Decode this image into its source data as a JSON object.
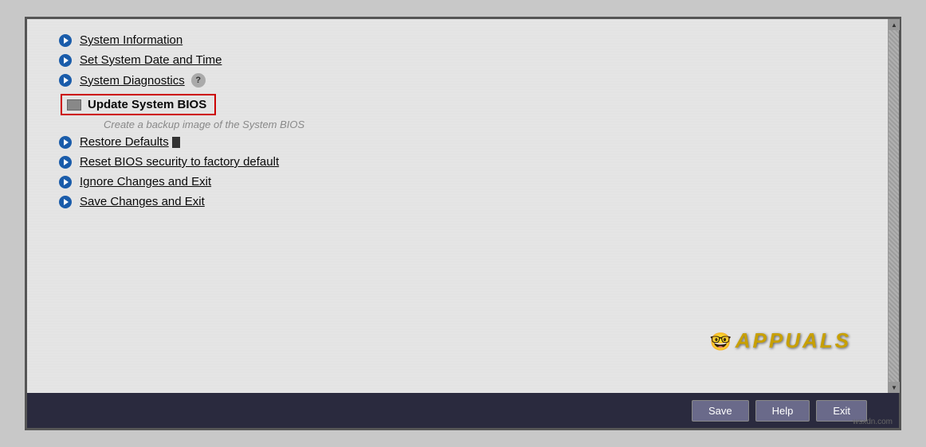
{
  "bios": {
    "menu_items": [
      {
        "id": "system-information",
        "label": "System Information",
        "has_bullet": true
      },
      {
        "id": "set-date-time",
        "label": "Set System Date and Time",
        "has_bullet": true
      },
      {
        "id": "system-diagnostics",
        "label": "System Diagnostics",
        "has_bullet": true,
        "has_help": true
      },
      {
        "id": "update-bios",
        "label": "Update System BIOS",
        "has_bullet": false,
        "highlighted": true
      },
      {
        "id": "backup-text",
        "label": "Create a backup image of the System BIOS",
        "is_subtext": true
      },
      {
        "id": "restore-defaults",
        "label": "Restore Defaults",
        "has_bullet": true
      },
      {
        "id": "reset-bios",
        "label": "Reset BIOS security to factory default",
        "has_bullet": true
      },
      {
        "id": "ignore-changes",
        "label": "Ignore Changes and Exit",
        "has_bullet": true
      },
      {
        "id": "save-changes",
        "label": "Save Changes and Exit",
        "has_bullet": true
      }
    ],
    "bottom_buttons": [
      {
        "id": "save",
        "label": "Save"
      },
      {
        "id": "help",
        "label": "Help"
      },
      {
        "id": "exit",
        "label": "Exit"
      }
    ],
    "appuals": {
      "text": "APPUALS",
      "mascot": "🤓"
    }
  },
  "scrollbar": {
    "up_arrow": "▲",
    "down_arrow": "▼"
  },
  "watermark": "wsxdn.com"
}
